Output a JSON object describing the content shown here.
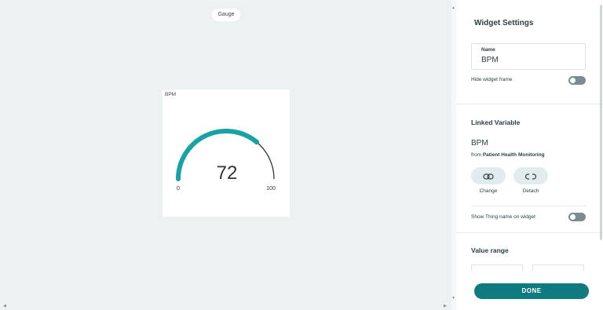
{
  "canvas": {
    "widget_type_chip": "Gauge",
    "widget": {
      "title": "BPM",
      "value": "72",
      "min_label": "0",
      "max_label": "100",
      "value_fraction": 0.72,
      "track_color": "#333333",
      "fill_color": "#17a2a5"
    }
  },
  "settings": {
    "title": "Widget Settings",
    "name_label": "Name",
    "name_value": "BPM",
    "hide_frame_label": "Hide widget frame",
    "hide_frame_on": false,
    "linked_section_title": "Linked Variable",
    "variable_name": "BPM",
    "from_prefix": "from",
    "thing_name": "Patient Health Monitoring",
    "change_label": "Change",
    "detach_label": "Detach",
    "change_icon": "link-icon",
    "detach_icon": "unlink-icon",
    "show_thing_label": "Show Thing name on widget",
    "show_thing_on": false,
    "value_range_title": "Value range",
    "done_label": "DONE",
    "accent_color": "#0f7b80"
  }
}
